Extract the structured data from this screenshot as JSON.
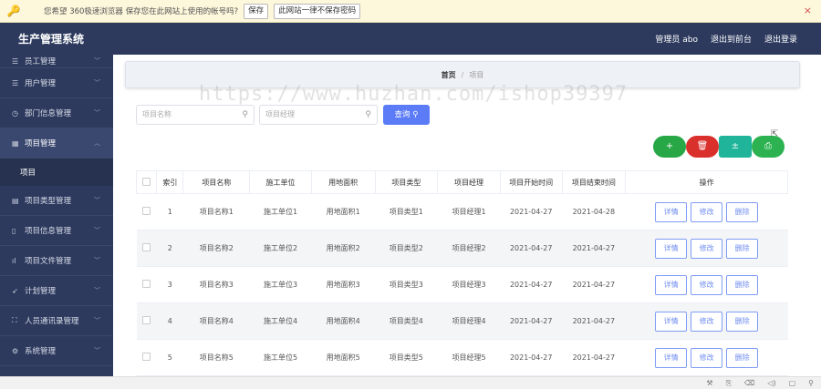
{
  "password_bar": {
    "message": "您希望 360极速浏览器 保存您在此网站上使用的帐号吗?",
    "save_label": "保存",
    "never_label": "此网站一律不保存密码",
    "close": "×"
  },
  "header": {
    "title": "生产管理系统",
    "user": "管理员 abo",
    "back_label": "退出到前台",
    "logout_label": "退出登录"
  },
  "sidebar": {
    "items": [
      {
        "label": "员工管理",
        "icon": "list-icon"
      },
      {
        "label": "用户管理",
        "icon": "list-icon"
      },
      {
        "label": "部门信息管理",
        "icon": "clock-icon"
      },
      {
        "label": "项目管理",
        "icon": "folder-icon"
      },
      {
        "label": "项目类型管理",
        "icon": "grid-icon"
      },
      {
        "label": "项目信息管理",
        "icon": "phone-icon"
      },
      {
        "label": "项目文件管理",
        "icon": "chart-icon"
      },
      {
        "label": "计划管理",
        "icon": "send-icon"
      },
      {
        "label": "人员通讯录管理",
        "icon": "frame-icon"
      },
      {
        "label": "系统管理",
        "icon": "settings-icon"
      }
    ],
    "sub_item": "项目"
  },
  "breadcrumb": {
    "home": "首页",
    "sep": "/",
    "current": "项目"
  },
  "watermark": "https://www.huzhan.com/ishop39397",
  "search": {
    "name_placeholder": "项目名称",
    "manager_placeholder": "项目经理",
    "query_label": "查询"
  },
  "actions": {
    "add": "+",
    "delete": "🗑",
    "export": "±",
    "print": "⎙"
  },
  "colors": {
    "header_bg": "#2d3a5e",
    "primary": "#5c7cf7",
    "add_green": "#27a745",
    "delete_red": "#d9302c",
    "export_teal": "#20b59a",
    "print_green": "#2cb250"
  },
  "table": {
    "headers": [
      "索引",
      "项目名称",
      "施工单位",
      "用地面积",
      "项目类型",
      "项目经理",
      "项目开始时间",
      "项目结束时间",
      "操作"
    ],
    "op_labels": {
      "detail": "详情",
      "edit": "修改",
      "delete": "删除"
    },
    "rows": [
      [
        "1",
        "项目名称1",
        "施工单位1",
        "用地面积1",
        "项目类型1",
        "项目经理1",
        "2021-04-27",
        "2021-04-28"
      ],
      [
        "2",
        "项目名称2",
        "施工单位2",
        "用地面积2",
        "项目类型2",
        "项目经理2",
        "2021-04-27",
        "2021-04-27"
      ],
      [
        "3",
        "项目名称3",
        "施工单位3",
        "用地面积3",
        "项目类型3",
        "项目经理3",
        "2021-04-27",
        "2021-04-27"
      ],
      [
        "4",
        "项目名称4",
        "施工单位4",
        "用地面积4",
        "项目类型4",
        "项目经理4",
        "2021-04-27",
        "2021-04-27"
      ],
      [
        "5",
        "项目名称5",
        "施工单位5",
        "用地面积5",
        "项目类型5",
        "项目经理5",
        "2021-04-27",
        "2021-04-27"
      ]
    ]
  }
}
